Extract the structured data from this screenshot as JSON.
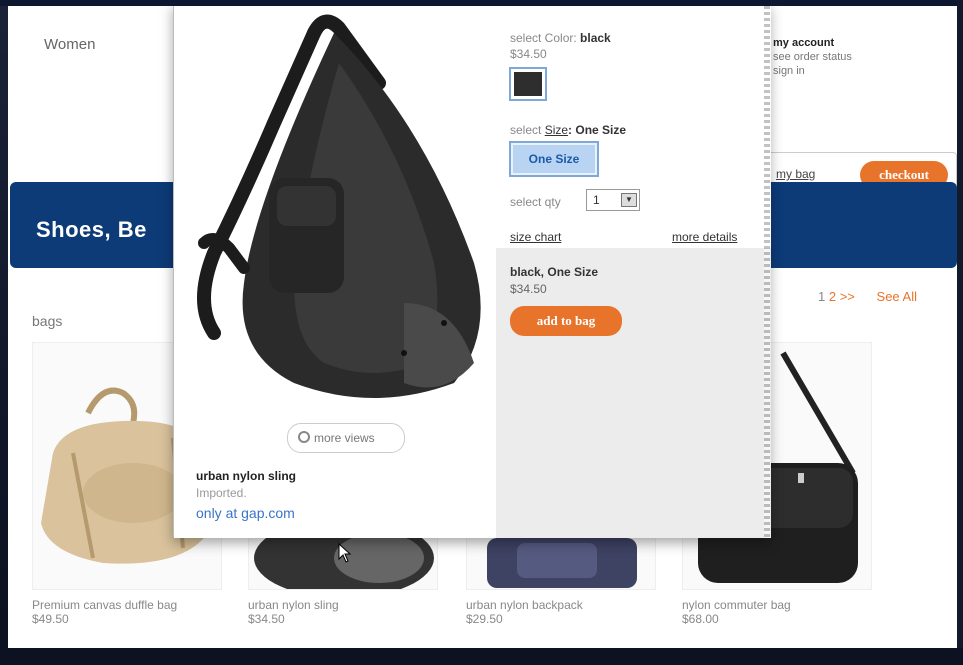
{
  "page": {
    "nav_women": "Women",
    "account": {
      "title": "my account",
      "order_status": "see order status",
      "sign_in": "sign in"
    },
    "bag": {
      "my_bag": "my bag",
      "checkout": "checkout"
    },
    "banner_title": "Shoes, Be",
    "category": "bags",
    "pager": {
      "page1": "1",
      "page2": "2",
      "next": ">>",
      "see_all": "See All"
    },
    "products": [
      {
        "name": "Premium canvas duffle bag",
        "price": "$49.50"
      },
      {
        "name": "urban nylon sling",
        "price": "$34.50"
      },
      {
        "name": "urban nylon backpack",
        "price": "$29.50"
      },
      {
        "name": "nylon commuter bag",
        "price": "$68.00"
      }
    ]
  },
  "modal": {
    "more_views": "more views",
    "product_title": "urban nylon sling",
    "product_subtitle": "Imported.",
    "exclusive_link": "only at gap.com",
    "select_color_label": "select Color:",
    "select_color_value": "black",
    "option_price": "$34.50",
    "select_size_prefix": "select",
    "select_size_link": "Size",
    "select_size_value": ": One Size",
    "size_option": "One Size",
    "qty_label": "select qty",
    "qty_value": "1",
    "size_chart": "size chart",
    "more_details": "more details",
    "summary_title": "black, One Size",
    "summary_price": "$34.50",
    "add_to_bag": "add to bag"
  },
  "colors": {
    "accent_orange": "#e8742c",
    "banner_blue": "#0d3b78",
    "link_blue": "#3a74c9",
    "swatch_black": "#2e2e2e"
  }
}
